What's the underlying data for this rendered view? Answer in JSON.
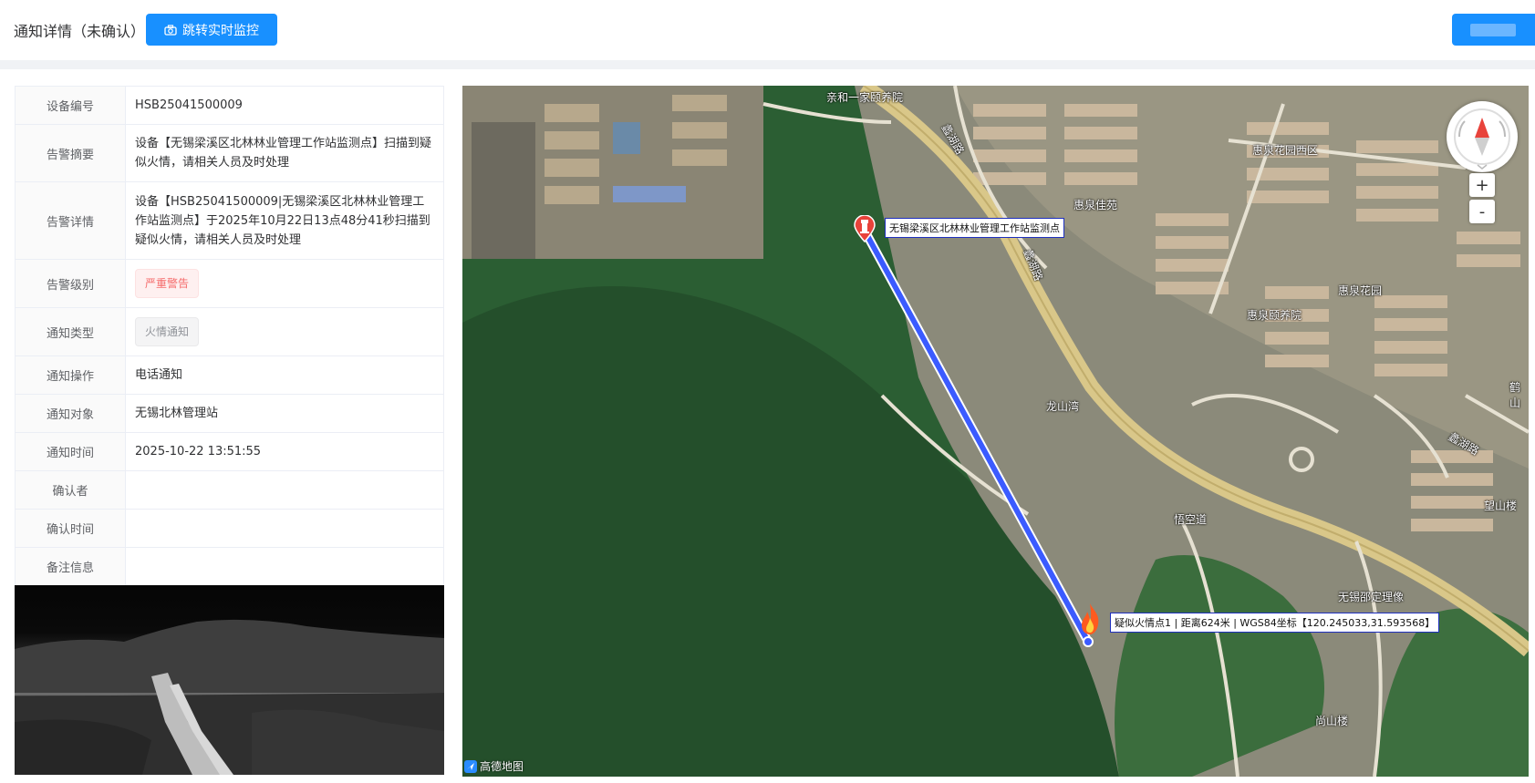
{
  "header": {
    "title": "通知详情（未确认）",
    "monitor_button": "跳转实时监控"
  },
  "info": {
    "rows": [
      {
        "label": "设备编号",
        "value": "HSB25041500009"
      },
      {
        "label": "告警摘要",
        "value": "设备【无锡梁溪区北林林业管理工作站监测点】扫描到疑似火情，请相关人员及时处理"
      },
      {
        "label": "告警详情",
        "value": "设备【HSB25041500009|无锡梁溪区北林林业管理工作站监测点】于2025年10月22日13点48分41秒扫描到疑似火情，请相关人员及时处理"
      },
      {
        "label": "告警级别",
        "value": "严重警告"
      },
      {
        "label": "通知类型",
        "value": "火情通知"
      },
      {
        "label": "通知操作",
        "value": "电话通知"
      },
      {
        "label": "通知对象",
        "value": "无锡北林管理站"
      },
      {
        "label": "通知时间",
        "value": "2025-10-22 13:51:55"
      },
      {
        "label": "确认者",
        "value": ""
      },
      {
        "label": "确认时间",
        "value": ""
      },
      {
        "label": "备注信息",
        "value": ""
      }
    ]
  },
  "map": {
    "device_label": "无锡梁溪区北林林业管理工作站监测点",
    "fire_label": "疑似火情点1 | 距离624米 | WGS84坐标【120.245033,31.593568】",
    "places": [
      "亲和一家颐养院",
      "蠡湖路",
      "蠡湖路",
      "惠泉花园西区",
      "惠泉佳苑",
      "惠泉颐养院",
      "惠泉花园",
      "龙山湾",
      "悟空道",
      "无锡邵定理像",
      "尚山楼",
      "望山楼",
      "蠡湖路",
      "鹤山"
    ],
    "zoom_in": "+",
    "zoom_out": "-",
    "provider": "高德地图"
  },
  "colors": {
    "primary": "#1890ff",
    "route": "#3b5bff",
    "danger": "#f56c6c"
  }
}
